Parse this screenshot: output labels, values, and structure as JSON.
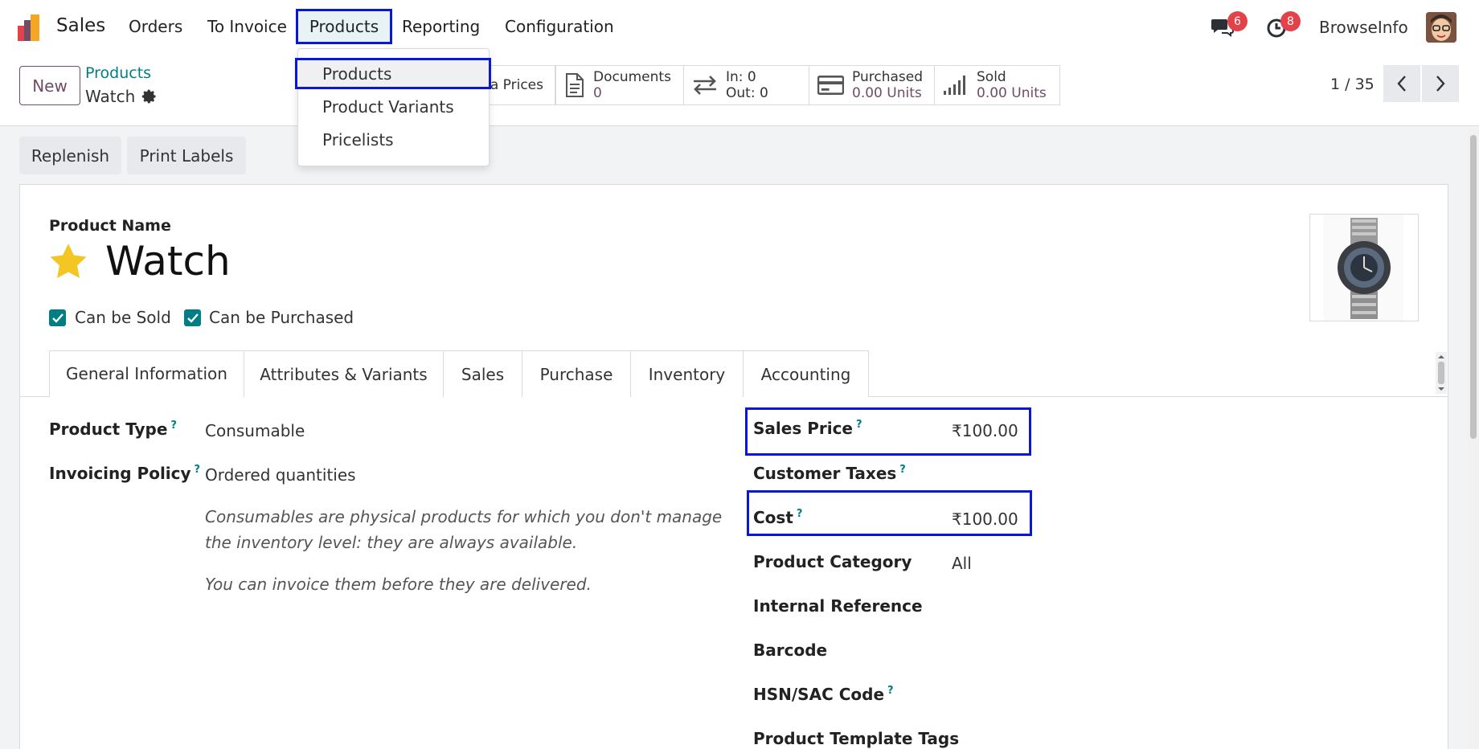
{
  "navbar": {
    "app_name": "Sales",
    "menu": [
      "Orders",
      "To Invoice",
      "Products",
      "Reporting",
      "Configuration"
    ],
    "messages_count": "6",
    "activities_count": "8",
    "user_name": "BrowseInfo"
  },
  "dropdown": {
    "items": [
      "Products",
      "Product Variants",
      "Pricelists"
    ]
  },
  "control_panel": {
    "new_label": "New",
    "breadcrumb_parent": "Products",
    "breadcrumb_current": "Watch",
    "smart_buttons": {
      "extra_prices": "ra Prices",
      "documents_label": "Documents",
      "documents_value": "0",
      "in_label": "In: 0",
      "out_label": "Out: 0",
      "purchased_label": "Purchased",
      "purchased_value": "0.00 Units",
      "sold_label": "Sold",
      "sold_value": "0.00 Units"
    },
    "pager": "1 / 35"
  },
  "actions": {
    "replenish": "Replenish",
    "print_labels": "Print Labels"
  },
  "form": {
    "product_name_label": "Product Name",
    "product_name": "Watch",
    "can_be_sold": "Can be Sold",
    "can_be_purchased": "Can be Purchased",
    "tabs": [
      "General Information",
      "Attributes & Variants",
      "Sales",
      "Purchase",
      "Inventory",
      "Accounting"
    ],
    "product_type_label": "Product Type",
    "product_type_value": "Consumable",
    "invoicing_policy_label": "Invoicing Policy",
    "invoicing_policy_value": "Ordered quantities",
    "help_1": "Consumables are physical products for which you don't manage the inventory level: they are always available.",
    "help_2": "You can invoice them before they are delivered.",
    "sales_price_label": "Sales Price",
    "sales_price_value": "₹100.00",
    "customer_taxes_label": "Customer Taxes",
    "cost_label": "Cost",
    "cost_value": "₹100.00",
    "product_category_label": "Product Category",
    "product_category_value": "All",
    "internal_reference_label": "Internal Reference",
    "barcode_label": "Barcode",
    "hsn_label": "HSN/SAC Code",
    "tags_label": "Product Template Tags",
    "help_mark": "?"
  },
  "colors": {
    "brand": "#714b67",
    "teal": "#017e84",
    "highlight": "#0a16d8",
    "badge": "#e2434b"
  }
}
